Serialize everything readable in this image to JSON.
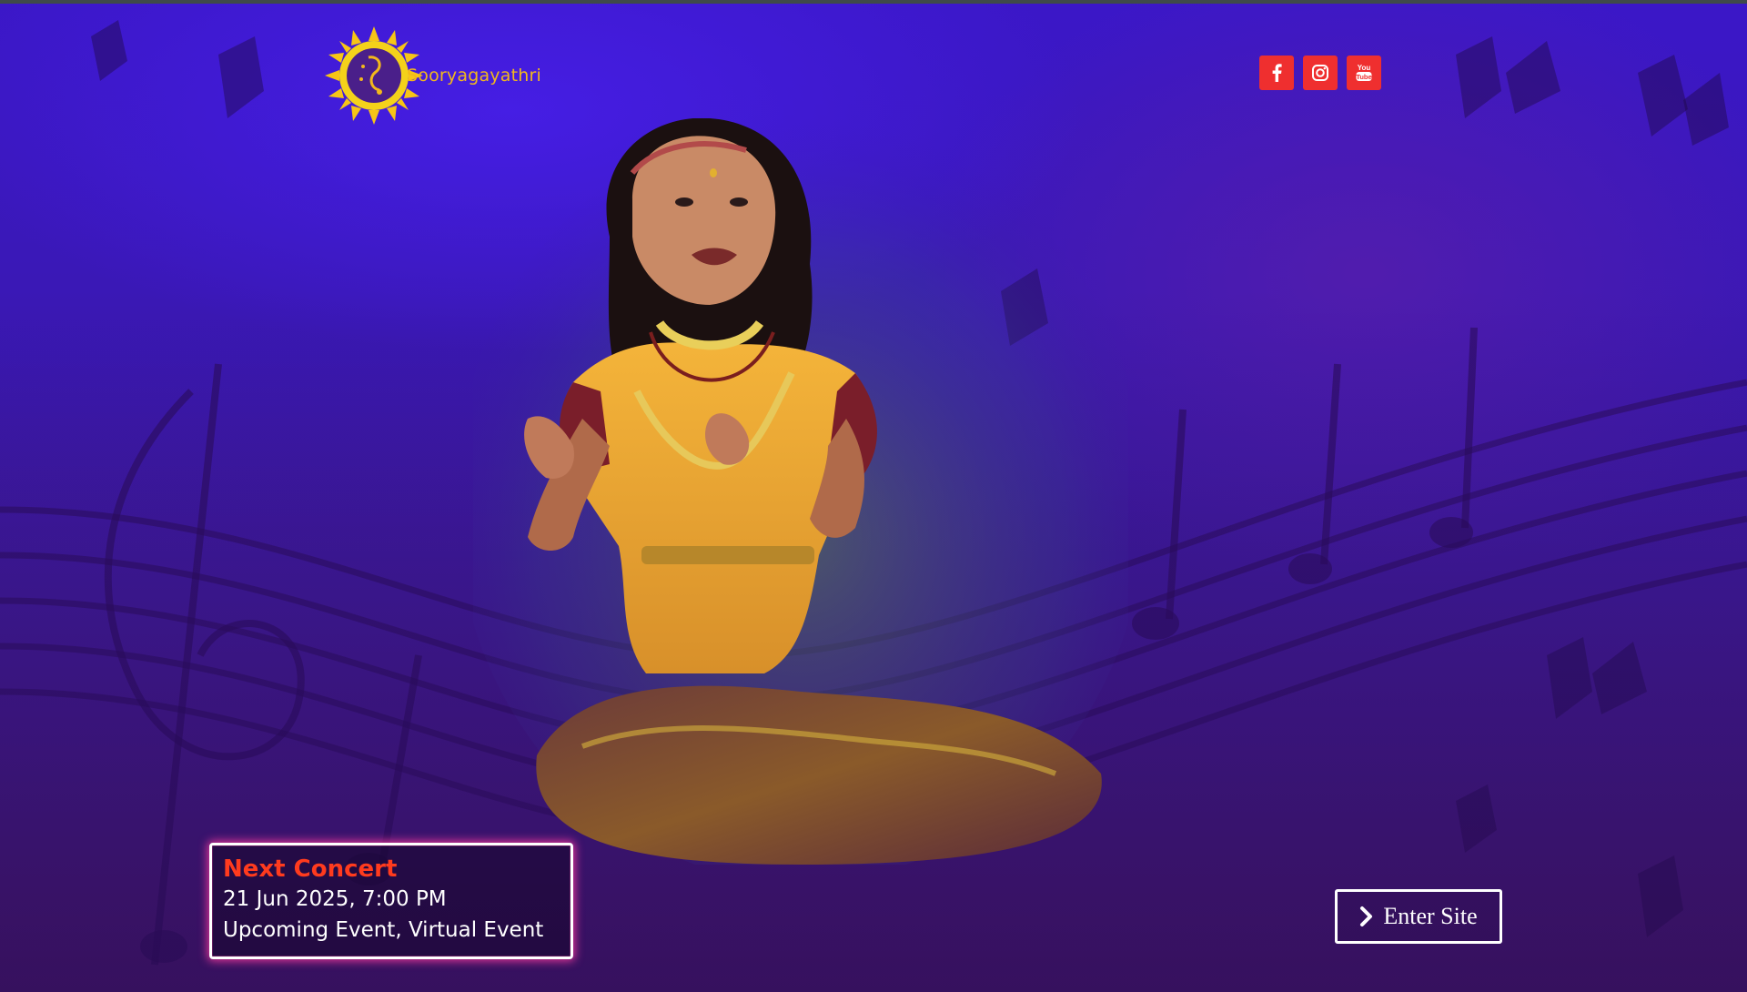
{
  "brand": {
    "name": "Sooryagayathri",
    "logo_icon": "sun-music-logo-icon",
    "accent": "#f2b81c"
  },
  "social": {
    "color": "#ef2f2f",
    "links": [
      {
        "icon": "facebook-icon"
      },
      {
        "icon": "instagram-icon"
      },
      {
        "icon": "youtube-icon"
      }
    ]
  },
  "concert": {
    "title": "Next Concert",
    "date": "21 Jun 2025, 7:00 PM",
    "categories": "Upcoming Event, Virtual Event",
    "title_color": "#ff3b1e"
  },
  "enter": {
    "label": "Enter Site",
    "icon": "chevron-right-icon"
  },
  "hero": {
    "image": "singer-performing-image"
  }
}
